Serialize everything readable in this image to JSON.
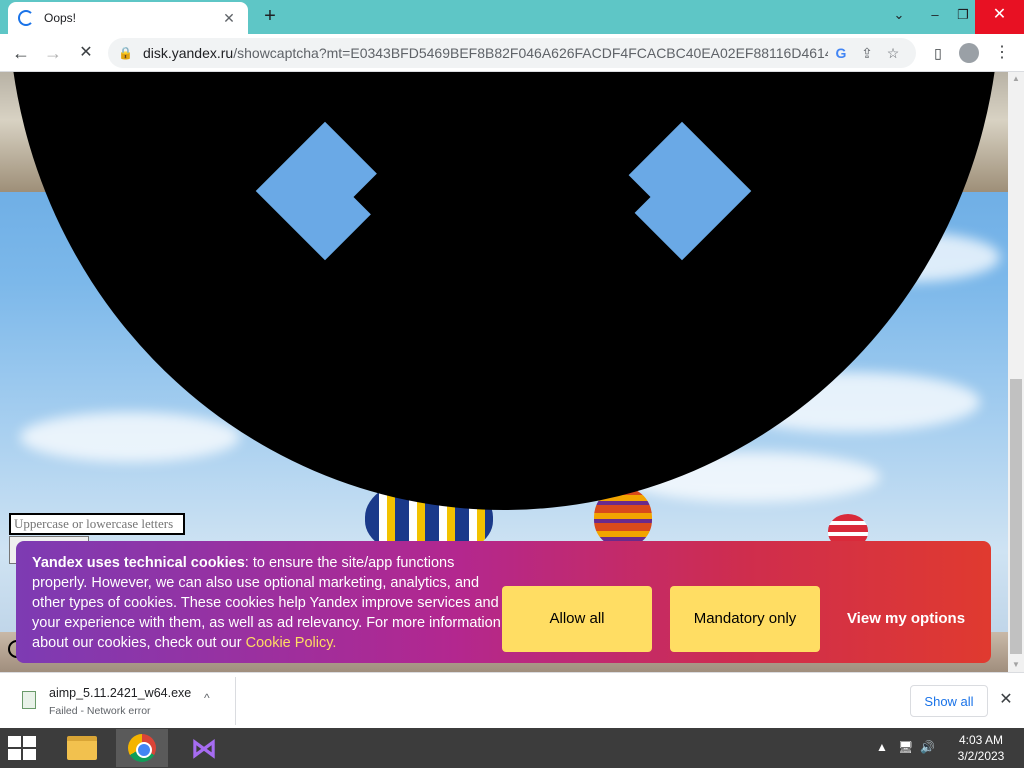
{
  "browser": {
    "tab_title": "Oops!",
    "new_tab": "+",
    "url_host": "disk.yandex.ru",
    "url_path": "/showcaptcha?mt=E0343BFD5469BEF8B82F046A626FACDF4FCACBC40EA02EF88116D461443...",
    "window_controls": {
      "chevron": "⌄",
      "minimize": "–",
      "restore": "❐",
      "close": "✕"
    }
  },
  "icons": {
    "back": "←",
    "forward": "→",
    "stop": "✕",
    "lock": "🔒",
    "google": "G",
    "share": "⇪",
    "star": "☆",
    "sidepanel": "▯",
    "menu": "⋮",
    "close": "✕",
    "caret_up": "^"
  },
  "captcha": {
    "input_placeholder": "Uppercase or lowercase letters"
  },
  "cookie_banner": {
    "bold_text": "Yandex uses technical cookies",
    "text": ": to ensure the site/app functions properly. However, we can also use optional marketing, analytics, and other types of cookies. These cookies help Yandex improve services and your experience with them, as well as ad relevancy. For more information about our cookies, check out our ",
    "policy_link": "Cookie Policy",
    "period": ".",
    "allow_all": "Allow all",
    "mandatory_only": "Mandatory only",
    "view_options": "View my options"
  },
  "downloads": {
    "file_name": "aimp_5.11.2421_w64.exe",
    "status": "Failed - Network error",
    "show_all": "Show all"
  },
  "taskbar": {
    "time": "4:03 AM",
    "date": "3/2/2023"
  }
}
